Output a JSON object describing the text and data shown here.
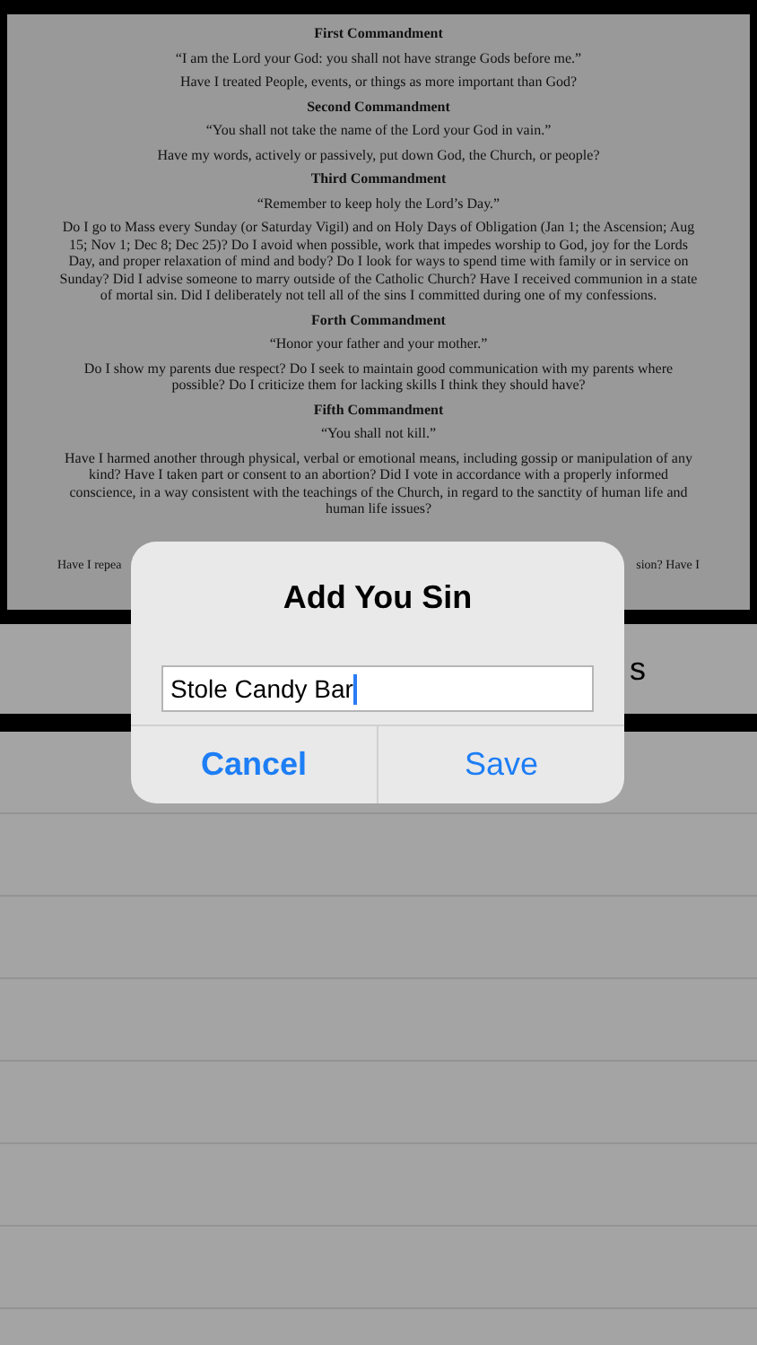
{
  "document": {
    "sections": [
      {
        "heading": "First Commandment",
        "quote": "“I am the Lord your God: you shall not have strange Gods before me.”",
        "questions": "Have I treated People, events, or things as more important than God?"
      },
      {
        "heading": "Second Commandment",
        "quote": "“You shall not take the name of the Lord your God in vain.”",
        "questions": "Have my words, actively or passively, put down God, the Church, or people?"
      },
      {
        "heading": "Third Commandment",
        "quote": "“Remember to keep holy the Lord’s Day.”",
        "questions": "Do I go to Mass every Sunday (or Saturday Vigil) and on Holy Days of Obligation (Jan 1; the Ascension; Aug 15; Nov 1; Dec 8; Dec 25)? Do I avoid when possible, work that impedes worship to God, joy for the Lords Day, and proper relaxation of mind and body? Do I look for ways to spend time with family or in service on Sunday? Did I advise someone to marry outside of the Catholic Church? Have I received communion in a state of mortal sin. Did I deliberately not tell all of the sins I committed during one of my confessions."
      },
      {
        "heading": "Forth Commandment",
        "quote": "“Honor your father and your mother.”",
        "questions": "Do I show my parents due respect? Do I seek to maintain good communication with my parents where possible? Do I criticize them for lacking skills I think they should have?"
      },
      {
        "heading": "Fifth Commandment",
        "quote": "“You shall not kill.”",
        "questions": "Have I harmed another through physical, verbal or emotional means, including gossip or manipulation of any kind? Have I taken part or consent to an abortion? Did I vote in accordance with a properly informed conscience, in a way consistent with the teachings of the Church, in regard to the sanctity of human life and human life issues?"
      }
    ],
    "cut_line": [
      "Have I repea",
      "sion? Have I"
    ]
  },
  "band_text": "s",
  "dialog": {
    "title": "Add You Sin",
    "input": {
      "value": "Stole Candy Bar",
      "focused": true
    },
    "buttons": [
      {
        "label": "Cancel",
        "kind": "cancel"
      },
      {
        "label": "Save",
        "kind": "default"
      }
    ]
  }
}
